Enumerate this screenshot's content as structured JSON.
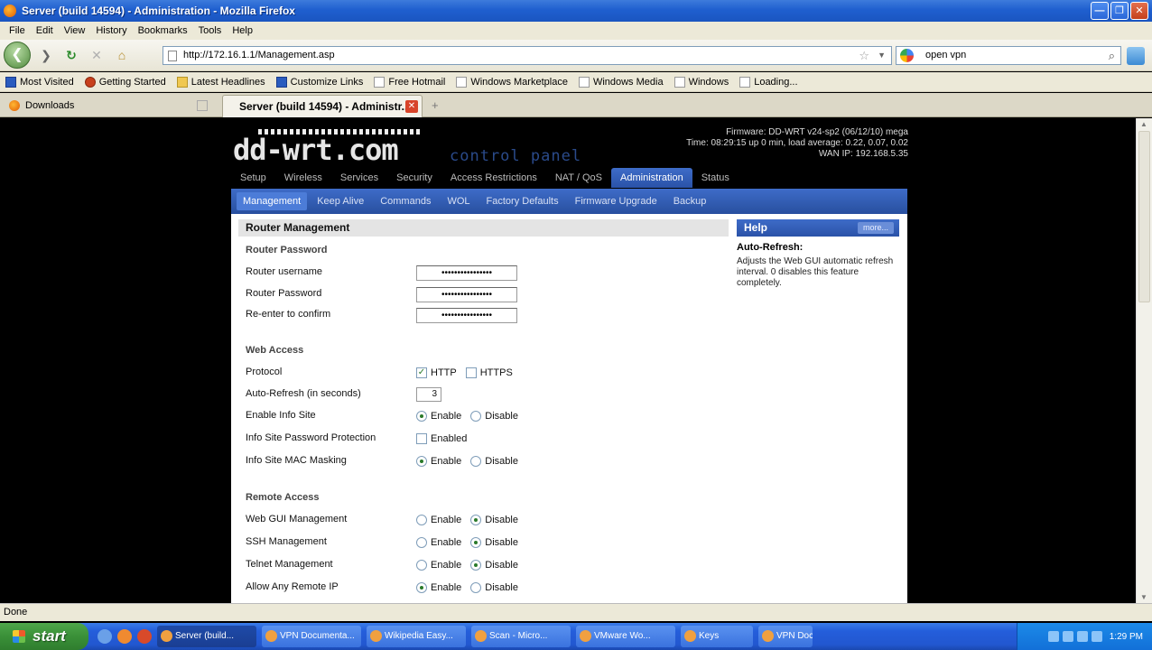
{
  "window": {
    "title": "Server (build 14594) - Administration - Mozilla Firefox",
    "min": "—",
    "max": "❐",
    "close": "✕"
  },
  "menu": [
    "File",
    "Edit",
    "View",
    "History",
    "Bookmarks",
    "Tools",
    "Help"
  ],
  "nav": {
    "back": "❮",
    "url": "http://172.16.1.1/Management.asp",
    "search": "open vpn"
  },
  "bookmarks": [
    {
      "label": "Most Visited",
      "icon": "blue"
    },
    {
      "label": "Getting Started",
      "icon": "red"
    },
    {
      "label": "Latest Headlines",
      "icon": "folder"
    },
    {
      "label": "Customize Links",
      "icon": "blue"
    },
    {
      "label": "Free Hotmail",
      "icon": "plain"
    },
    {
      "label": "Windows Marketplace",
      "icon": "plain"
    },
    {
      "label": "Windows Media",
      "icon": "plain"
    },
    {
      "label": "Windows",
      "icon": "plain"
    },
    {
      "label": "Loading...",
      "icon": "plain"
    }
  ],
  "tabs": {
    "downloads": "Downloads",
    "active": "Server (build 14594) - Administr...",
    "close": "✕",
    "new": "+"
  },
  "router": {
    "logo": "dd-wrt.com",
    "panel": "control panel",
    "firmware": "Firmware: DD-WRT v24-sp2 (06/12/10) mega",
    "time": "Time: 08:29:15 up 0 min, load average: 0.22, 0.07, 0.02",
    "wan": "WAN IP: 192.168.5.35",
    "main_tabs": [
      "Setup",
      "Wireless",
      "Services",
      "Security",
      "Access Restrictions",
      "NAT / QoS",
      "Administration",
      "Status"
    ],
    "active_main": 6,
    "sub_tabs": [
      "Management",
      "Keep Alive",
      "Commands",
      "WOL",
      "Factory Defaults",
      "Firmware Upgrade",
      "Backup"
    ],
    "active_sub": 0
  },
  "section": {
    "title": "Router Management",
    "password_group": "Router Password",
    "username_label": "Router username",
    "username_value": "••••••••••••••••",
    "password_label": "Router Password",
    "password_value": "••••••••••••••••",
    "confirm_label": "Re-enter to confirm",
    "confirm_value": "••••••••••••••••",
    "web_access_group": "Web Access",
    "protocol_label": "Protocol",
    "http": "HTTP",
    "https": "HTTPS",
    "autorefresh_label": "Auto-Refresh (in seconds)",
    "autorefresh_value": "3",
    "infosite_label": "Enable Info Site",
    "infopw_label": "Info Site Password Protection",
    "enabled": "Enabled",
    "infomac_label": "Info Site MAC Masking",
    "remote_group": "Remote Access",
    "webgui_label": "Web GUI Management",
    "ssh_label": "SSH Management",
    "telnet_label": "Telnet Management",
    "anyip_label": "Allow Any Remote IP",
    "enable": "Enable",
    "disable": "Disable"
  },
  "help": {
    "title": "Help",
    "more": "more...",
    "subtitle": "Auto-Refresh:",
    "text": "Adjusts the Web GUI automatic refresh interval. 0 disables this feature completely."
  },
  "status": "Done",
  "taskbar": {
    "start": "start",
    "tasks": [
      "Server (build...",
      "VPN Documenta...",
      "Wikipedia Easy...",
      "Scan - Micro...",
      "VMware Wo...",
      "Keys",
      "VPN Documentatio..."
    ],
    "clock": "1:29 PM"
  }
}
